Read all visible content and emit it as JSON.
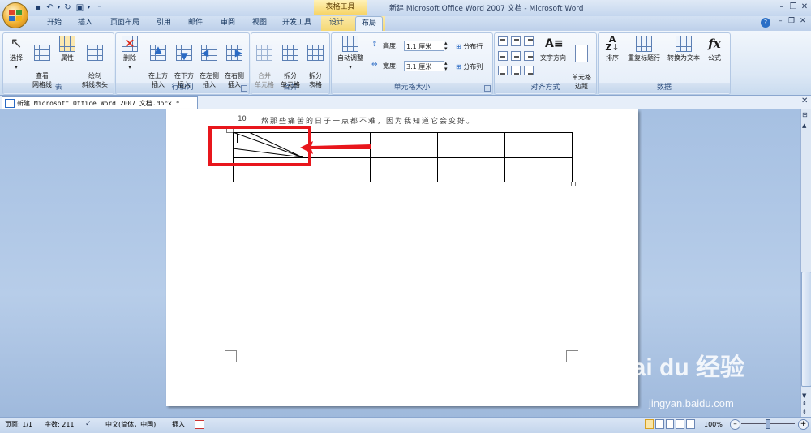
{
  "window": {
    "title": "新建 Microsoft Office Word 2007 文档 - Microsoft Word",
    "context_tab_group": "表格工具"
  },
  "tabs": [
    "开始",
    "插入",
    "页面布局",
    "引用",
    "邮件",
    "审阅",
    "视图",
    "开发工具",
    "设计",
    "布局"
  ],
  "active_tab": "布局",
  "ribbon": {
    "table_group": {
      "label": "表",
      "buttons": [
        "选择",
        "查看\n网格线",
        "属性",
        "绘制\n斜线表头"
      ]
    },
    "rows_cols_group": {
      "label": "行和列",
      "buttons": [
        "删除",
        "在上方\n插入",
        "在下方\n插入",
        "在左侧\n插入",
        "在右侧\n插入"
      ]
    },
    "merge_group": {
      "label": "合并",
      "buttons": [
        "合并\n单元格",
        "拆分\n单元格",
        "拆分\n表格"
      ]
    },
    "cell_size_group": {
      "label": "单元格大小",
      "autofit": "自动调整",
      "height_label": "高度:",
      "height_value": "1.1 厘米",
      "width_label": "宽度:",
      "width_value": "3.1 厘米",
      "distribute_rows": "分布行",
      "distribute_cols": "分布列"
    },
    "align_group": {
      "label": "对齐方式",
      "text_direction": "文字方向",
      "cell_margins": "单元格\n边距"
    },
    "data_group": {
      "label": "数据",
      "buttons": [
        "排序",
        "重复标题行",
        "转换为文本",
        "公式"
      ]
    }
  },
  "document_tab": "新建 Microsoft Office Word 2007 文档.docx *",
  "document": {
    "line_number": "10",
    "line_text": "熬那些痛苦的日子一点都不难，因为我知道它会变好。"
  },
  "status_bar": {
    "page": "页面: 1/1",
    "words": "字数: 211",
    "language": "中文(简体，中国)",
    "mode": "插入",
    "zoom": "100%"
  },
  "watermark": {
    "brand": "Bai du 经验",
    "url": "jingyan.baidu.com"
  },
  "colors": {
    "annotation_red": "#e8161c",
    "ribbon_bg": "#dbe7f5",
    "context_tab": "#f6d468"
  }
}
